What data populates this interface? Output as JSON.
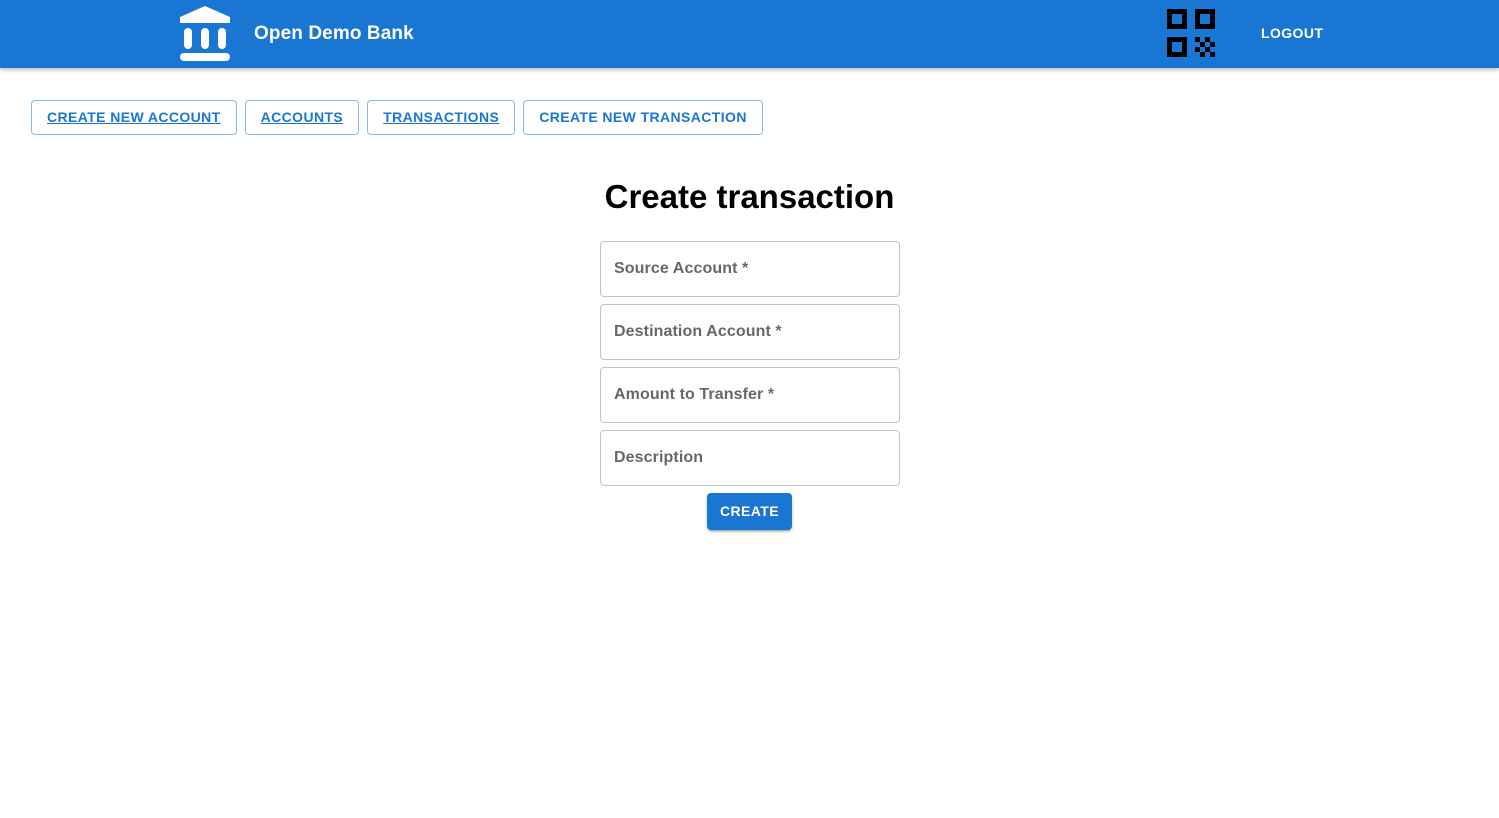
{
  "app": {
    "title": "Open Demo Bank",
    "logo_icon": "bank-icon",
    "qr_icon": "qr-code-icon",
    "logout_label": "LOGOUT",
    "accent_color": "#1976d2"
  },
  "nav": {
    "items": [
      {
        "label": "CREATE NEW ACCOUNT"
      },
      {
        "label": "ACCOUNTS"
      },
      {
        "label": "TRANSACTIONS"
      },
      {
        "label": "CREATE NEW TRANSACTION"
      }
    ]
  },
  "page": {
    "title": "Create transaction"
  },
  "form": {
    "fields": [
      {
        "label": "Source Account *",
        "value": ""
      },
      {
        "label": "Destination Account *",
        "value": ""
      },
      {
        "label": "Amount to Transfer *",
        "value": ""
      },
      {
        "label": "Description",
        "value": ""
      }
    ],
    "submit_label": "CREATE"
  }
}
